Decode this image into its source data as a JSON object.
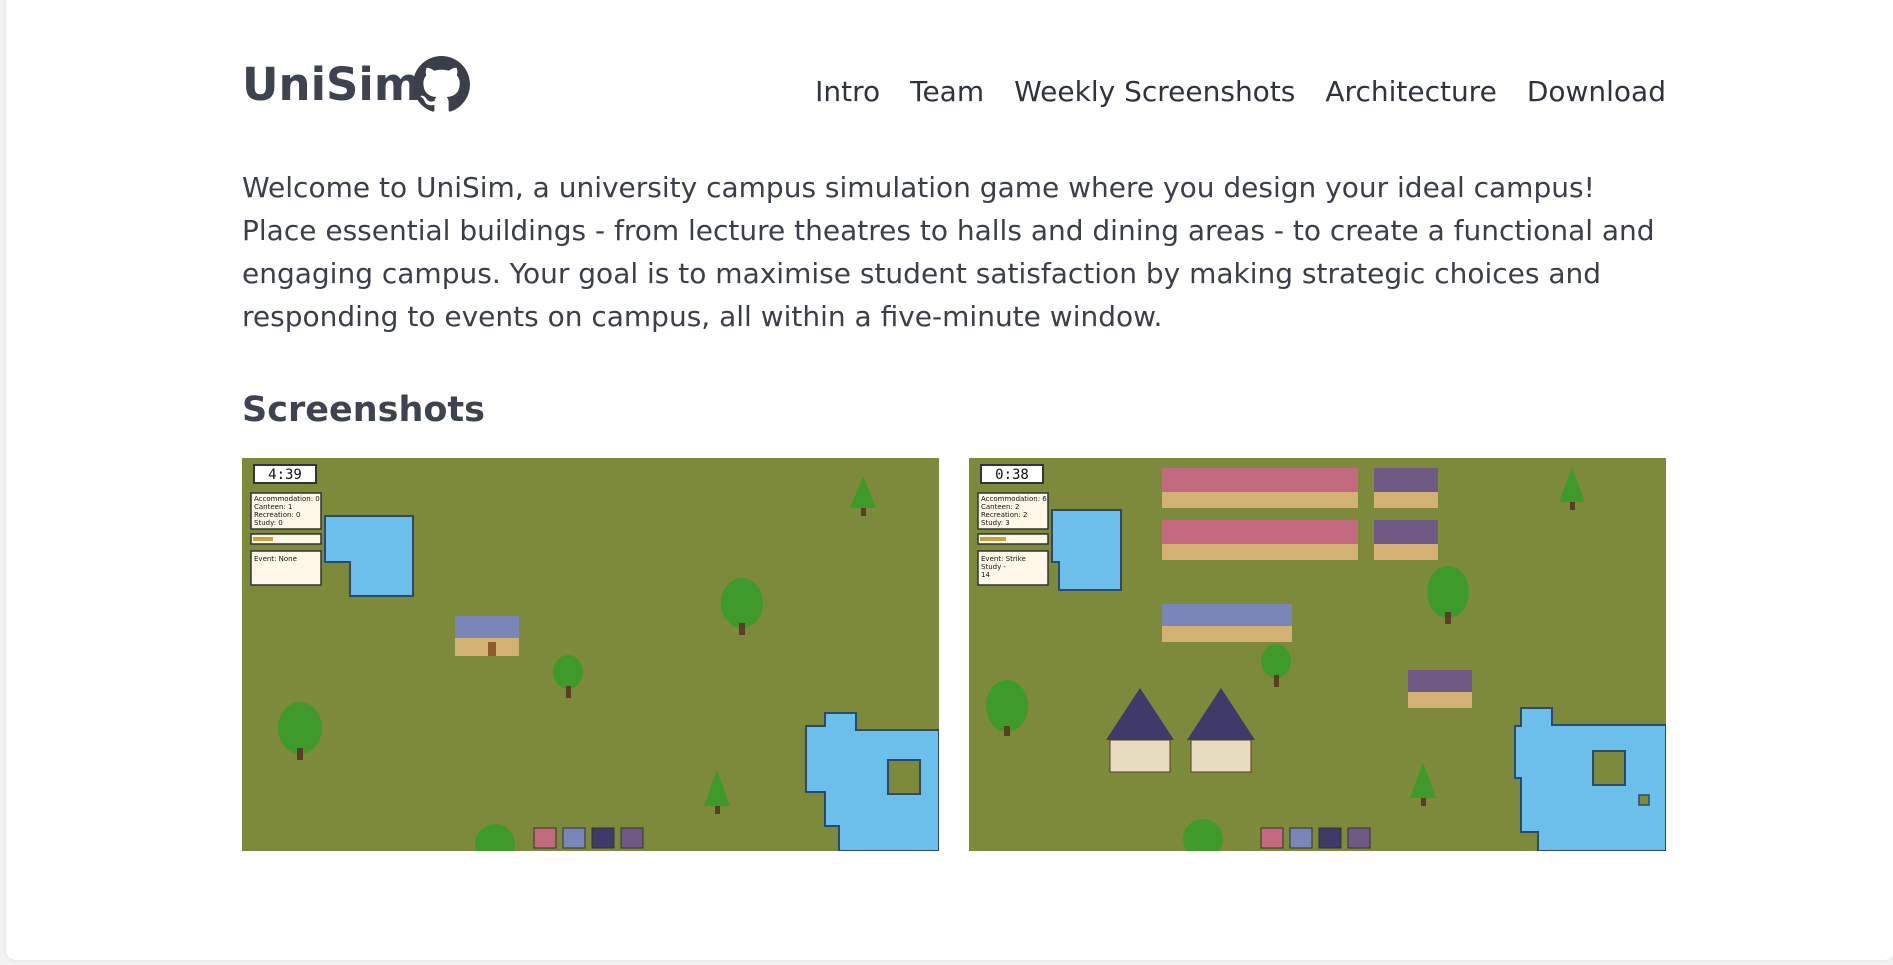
{
  "header": {
    "title": "UniSim",
    "github_icon": "github-icon"
  },
  "nav": {
    "items": [
      {
        "label": "Intro"
      },
      {
        "label": "Team"
      },
      {
        "label": "Weekly Screenshots"
      },
      {
        "label": "Architecture"
      },
      {
        "label": "Download"
      }
    ]
  },
  "intro": {
    "text": "Welcome to UniSim, a university campus simulation game where you design your ideal campus! Place essential buildings - from lecture theatres to halls and dining areas - to create a functional and engaging campus. Your goal is to maximise student satisfaction by making strategic choices and responding to events on campus, all within a five-minute window."
  },
  "screenshots": {
    "heading": "Screenshots",
    "items": [
      {
        "timer": "4:39",
        "stats": [
          "Accommodation: 0",
          "Canteen: 1",
          "Recreation: 0",
          "Study: 0"
        ],
        "event": [
          "Event: None"
        ]
      },
      {
        "timer": "0:38",
        "stats": [
          "Accommodation: 6",
          "Canteen: 2",
          "Recreation: 2",
          "Study: 3"
        ],
        "event": [
          "Event: Strike",
          "Study -",
          "14"
        ]
      }
    ]
  },
  "colors": {
    "grass": "#7d8a3c",
    "water": "#6bbfea",
    "tree": "#3f9a2c",
    "roof_pink": "#c36a80",
    "roof_blue": "#7a86b8",
    "roof_purple": "#6f5a86",
    "roof_dark": "#3e3a6a"
  }
}
